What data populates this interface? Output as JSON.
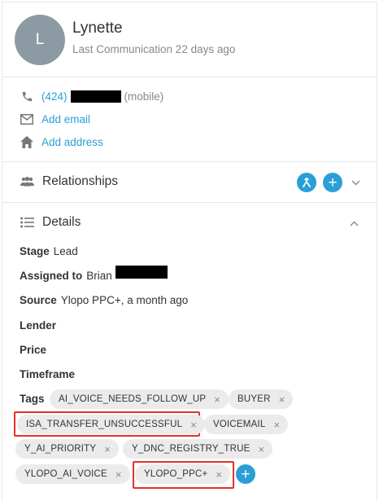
{
  "contact": {
    "avatar_initial": "L",
    "name": "Lynette",
    "last_communication": "Last Communication 22 days ago",
    "phone_prefix": "(424)",
    "phone_type": "(mobile)",
    "add_email": "Add email",
    "add_address": "Add address"
  },
  "sections": {
    "relationships": "Relationships",
    "details": "Details"
  },
  "details": {
    "stage_label": "Stage",
    "stage_value": "Lead",
    "assigned_label": "Assigned to",
    "assigned_value": "Brian",
    "source_label": "Source",
    "source_value": "Ylopo PPC+, a month ago",
    "lender_label": "Lender",
    "price_label": "Price",
    "timeframe_label": "Timeframe",
    "tags_label": "Tags"
  },
  "tags": [
    "AI_VOICE_NEEDS_FOLLOW_UP",
    "BUYER",
    "ISA_TRANSFER_UNSUCCESSFUL",
    "VOICEMAIL",
    "Y_AI_PRIORITY",
    "Y_DNC_REGISTRY_TRUE",
    "YLOPO_AI_VOICE",
    "YLOPO_PPC+"
  ],
  "highlighted_tags": [
    "ISA_TRANSFER_UNSUCCESSFUL",
    "YLOPO_PPC+"
  ],
  "colors": {
    "accent": "#2a9fd6",
    "highlight": "#e4302b",
    "tag_bg": "#ebebeb",
    "avatar_bg": "#8c9ba3"
  },
  "icons": {
    "remove_tag": "×",
    "add": "+"
  }
}
